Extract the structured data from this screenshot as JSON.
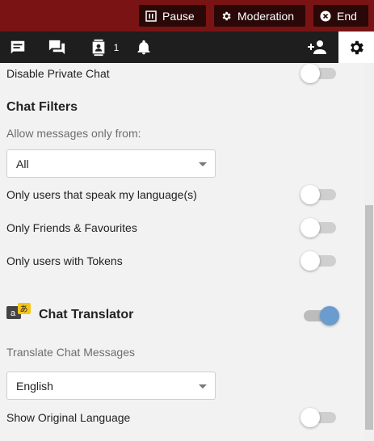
{
  "header": {
    "pause_label": "Pause",
    "moderation_label": "Moderation",
    "end_label": "End"
  },
  "tabs": {
    "users_count": "1"
  },
  "settings": {
    "disable_private_chat": {
      "label": "Disable Private Chat",
      "on": false
    },
    "chat_filters": {
      "title": "Chat Filters",
      "allow_label": "Allow messages only from:",
      "allow_value": "All",
      "options": [
        {
          "label": "Only users that speak my language(s)",
          "on": false
        },
        {
          "label": "Only Friends & Favourites",
          "on": false
        },
        {
          "label": "Only users with Tokens",
          "on": false
        }
      ]
    },
    "chat_translator": {
      "title": "Chat Translator",
      "on": true,
      "translate_label": "Translate Chat Messages",
      "language_value": "English",
      "show_original": {
        "label": "Show Original Language",
        "on": false
      }
    }
  },
  "colors": {
    "header_bg": "#7a1414",
    "tabbar_bg": "#1e1e1e",
    "toggle_on": "#6a9ccf"
  }
}
